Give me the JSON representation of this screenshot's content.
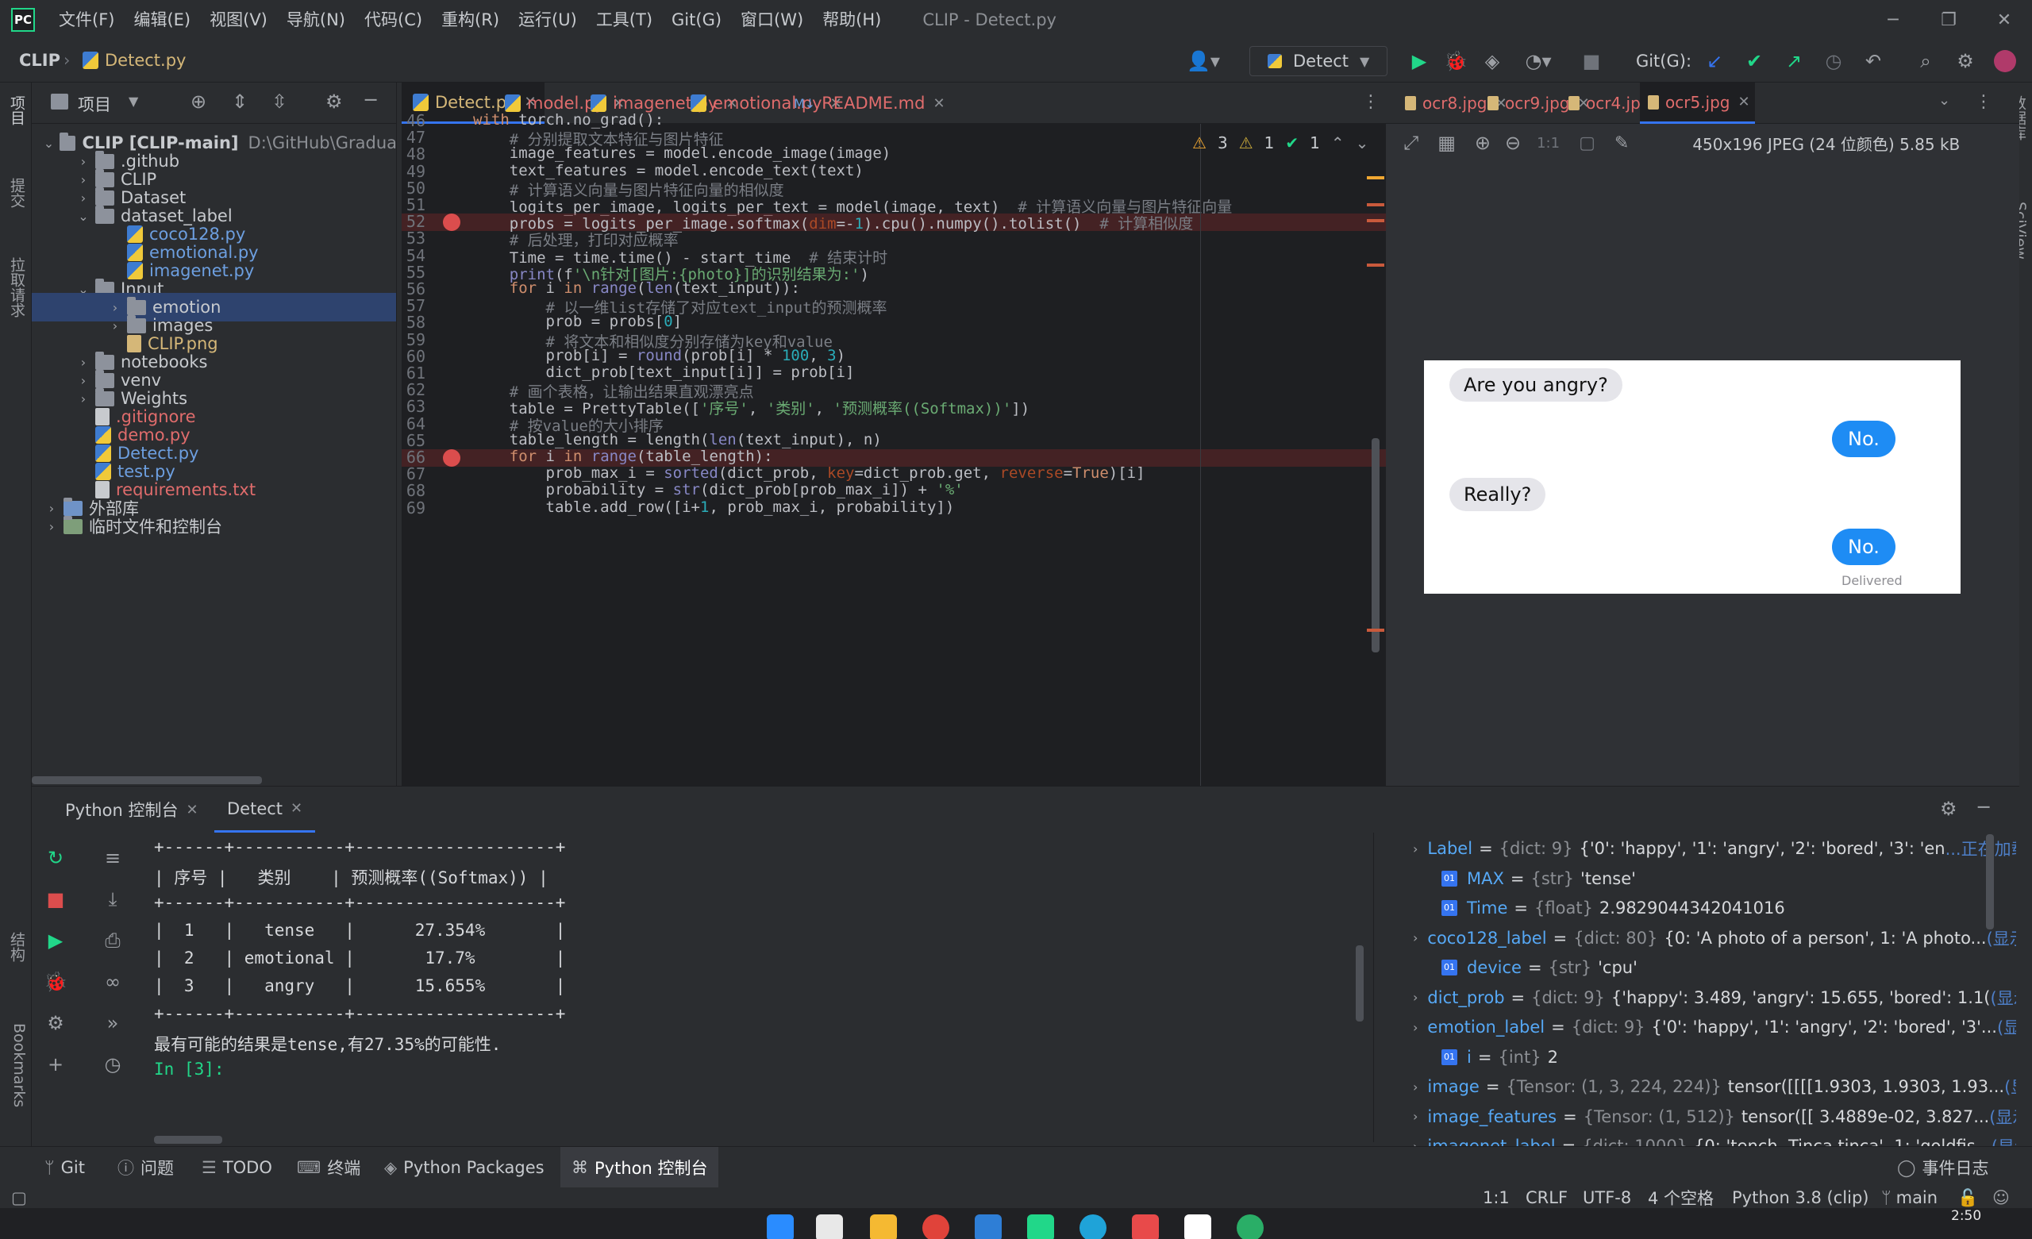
{
  "titlebar": {
    "menu": [
      "文件(F)",
      "编辑(E)",
      "视图(V)",
      "导航(N)",
      "代码(C)",
      "重构(R)",
      "运行(U)",
      "工具(T)",
      "Git(G)",
      "窗口(W)",
      "帮助(H)"
    ],
    "window_title": "CLIP - Detect.py"
  },
  "navbar": {
    "project": "CLIP",
    "file": "Detect.py",
    "run_config": "Detect",
    "git_label": "Git(G):"
  },
  "left_strip": {
    "project": "项目",
    "commit": "提交",
    "pull": "拉取请求",
    "structure": "结构",
    "bookmarks": "Bookmarks"
  },
  "right_strip": {
    "database": "数据库",
    "sciview": "SciView"
  },
  "project_panel": {
    "title": "项目",
    "tree": [
      {
        "label": "CLIP [CLIP-main]",
        "path": "D:\\GitHub\\Gradua",
        "type": "root"
      },
      {
        "label": ".github",
        "type": "folder"
      },
      {
        "label": "CLIP",
        "type": "folder"
      },
      {
        "label": "Dataset",
        "type": "folder"
      },
      {
        "label": "dataset_label",
        "type": "folder-open"
      },
      {
        "label": "coco128.py",
        "type": "py-child"
      },
      {
        "label": "emotional.py",
        "type": "py-child"
      },
      {
        "label": "imagenet.py",
        "type": "py-child"
      },
      {
        "label": "Input",
        "type": "folder-open"
      },
      {
        "label": "emotion",
        "type": "folder-child-selected"
      },
      {
        "label": "images",
        "type": "folder-child"
      },
      {
        "label": "CLIP.png",
        "type": "png-child"
      },
      {
        "label": "notebooks",
        "type": "folder"
      },
      {
        "label": "venv",
        "type": "folder"
      },
      {
        "label": "Weights",
        "type": "folder"
      },
      {
        "label": ".gitignore",
        "type": "file-red"
      },
      {
        "label": "demo.py",
        "type": "py-red"
      },
      {
        "label": "Detect.py",
        "type": "py-blue"
      },
      {
        "label": "test.py",
        "type": "py-blue"
      },
      {
        "label": "requirements.txt",
        "type": "txt-red"
      },
      {
        "label": "外部库",
        "type": "lib"
      },
      {
        "label": "临时文件和控制台",
        "type": "scratch"
      }
    ]
  },
  "editor": {
    "tabs": [
      "Detect.py",
      "model.py",
      "imagenet.py",
      "emotional.py",
      "README.md"
    ],
    "inspections": {
      "warnings": "3",
      "weak": "1",
      "ok": "1"
    },
    "lines": [
      {
        "n": "46",
        "code": "with torch.no_grad():"
      },
      {
        "n": "47",
        "code": "    # 分别提取文本特征与图片特征"
      },
      {
        "n": "48",
        "code": "    image_features = model.encode_image(image)"
      },
      {
        "n": "49",
        "code": "    text_features = model.encode_text(text)"
      },
      {
        "n": "50",
        "code": "    # 计算语义向量与图片特征向量的相似度"
      },
      {
        "n": "51",
        "code": "    logits_per_image, logits_per_text = model(image, text)  # 计算语义向量与图片特征向量"
      },
      {
        "n": "52",
        "code": "    probs = logits_per_image.softmax(dim=-1).cpu().numpy().tolist()  # 计算相似度"
      },
      {
        "n": "53",
        "code": "    # 后处理，打印对应概率"
      },
      {
        "n": "54",
        "code": "    Time = time.time() - start_time  # 结束计时"
      },
      {
        "n": "55",
        "code": "    print(f'\\n针对[图片:{photo}]的识别结果为:')"
      },
      {
        "n": "56",
        "code": "    for i in range(len(text_input)):"
      },
      {
        "n": "57",
        "code": "        # 以一维list存储了对应text_input的预测概率"
      },
      {
        "n": "58",
        "code": "        prob = probs[0]"
      },
      {
        "n": "59",
        "code": "        # 将文本和相似度分别存储为key和value"
      },
      {
        "n": "60",
        "code": "        prob[i] = round(prob[i] * 100, 3)"
      },
      {
        "n": "61",
        "code": "        dict_prob[text_input[i]] = prob[i]"
      },
      {
        "n": "62",
        "code": "    # 画个表格，让输出结果直观漂亮点"
      },
      {
        "n": "63",
        "code": "    table = PrettyTable(['序号', '类别', '预测概率((Softmax))'])"
      },
      {
        "n": "64",
        "code": "    # 按value的大小排序"
      },
      {
        "n": "65",
        "code": "    table_length = length(len(text_input), n)"
      },
      {
        "n": "66",
        "code": "    for i in range(table_length):"
      },
      {
        "n": "67",
        "code": "        prob_max_i = sorted(dict_prob, key=dict_prob.get, reverse=True)[i]"
      },
      {
        "n": "68",
        "code": "        probability = str(dict_prob[prob_max_i]) + '%'"
      },
      {
        "n": "69",
        "code": "        table.add_row([i+1, prob_max_i, probability])"
      }
    ]
  },
  "viewer": {
    "tabs": [
      "ocr8.jpg",
      "ocr9.jpg",
      "ocr4.jpg",
      "ocr5.jpg"
    ],
    "info": "450x196 JPEG (24 位颜色) 5.85 kB",
    "zoom_icon_text": "1:1",
    "chat": {
      "msg1": "Are you angry?",
      "reply1": "No.",
      "msg2": "Really?",
      "reply2": "No.",
      "delivered": "Delivered"
    }
  },
  "bottom": {
    "tabs": [
      "Python 控制台",
      "Detect"
    ],
    "output": [
      "+------+-----------+--------------------+",
      "| 序号 |   类别    | 预测概率((Softmax)) |",
      "+------+-----------+--------------------+",
      "|  1   |   tense   |      27.354%       |",
      "|  2   | emotional |       17.7%        |",
      "|  3   |   angry   |      15.655%       |",
      "+------+-----------+--------------------+",
      "最有可能的结果是tense,有27.35%的可能性.",
      "In [3]:"
    ],
    "variables": [
      {
        "name": "Label",
        "meta": "{dict: 9}",
        "val": "{'0': 'happy', '1': 'angry', '2': 'bored', '3': 'en",
        "link": "...正在加载...",
        "exp": true,
        "kind": "dict"
      },
      {
        "name": "MAX",
        "meta": "{str}",
        "val": "'tense'",
        "link": "",
        "exp": false,
        "kind": "prim"
      },
      {
        "name": "Time",
        "meta": "{float}",
        "val": "2.9829044342041016",
        "link": "",
        "exp": false,
        "kind": "prim"
      },
      {
        "name": "coco128_label",
        "meta": "{dict: 80}",
        "val": "{0: 'A photo of a person', 1: 'A photo...",
        "link": "(显示)",
        "exp": true,
        "kind": "dict"
      },
      {
        "name": "device",
        "meta": "{str}",
        "val": "'cpu'",
        "link": "",
        "exp": false,
        "kind": "prim"
      },
      {
        "name": "dict_prob",
        "meta": "{dict: 9}",
        "val": "{'happy': 3.489, 'angry': 15.655, 'bored': 1.1(",
        "link": "(显示)",
        "exp": true,
        "kind": "dict"
      },
      {
        "name": "emotion_label",
        "meta": "{dict: 9}",
        "val": "{'0': 'happy', '1': 'angry', '2': 'bored', '3'...",
        "link": "(显示)",
        "exp": true,
        "kind": "dict"
      },
      {
        "name": "i",
        "meta": "{int}",
        "val": "2",
        "link": "",
        "exp": false,
        "kind": "prim"
      },
      {
        "name": "image",
        "meta": "{Tensor: (1, 3, 224, 224)}",
        "val": "tensor([[[[1.9303, 1.9303, 1.93...",
        "link": "(显示)",
        "exp": true,
        "kind": "dict"
      },
      {
        "name": "image_features",
        "meta": "{Tensor: (1, 512)}",
        "val": "tensor([[ 3.4889e-02,  3.827...",
        "link": "(显示)",
        "exp": true,
        "kind": "dict"
      },
      {
        "name": "imagenet_label",
        "meta": "{dict: 1000}",
        "val": "{0: 'tench, Tinca tinca', 1: 'goldfis...",
        "link": "(显示)",
        "exp": true,
        "kind": "dict"
      }
    ]
  },
  "tooltabs": [
    "Git",
    "问题",
    "TODO",
    "终端",
    "Python Packages",
    "Python 控制台"
  ],
  "event_log": "事件日志",
  "status": {
    "pos": "1:1",
    "eol": "CRLF",
    "enc": "UTF-8",
    "indent": "4 个空格",
    "interp": "Python 3.8 (clip)",
    "branch": "main"
  },
  "clock": "2:50",
  "colors": {
    "bg": "#2b2d30",
    "editor": "#1e1f22",
    "accent": "#3574f0",
    "run": "#21d789",
    "breakpoint": "#db4d4d"
  }
}
